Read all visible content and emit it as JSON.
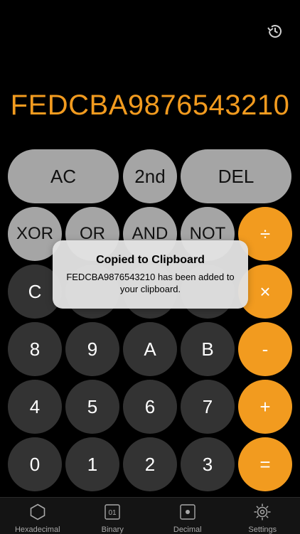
{
  "display": {
    "value": "FEDCBA9876543210"
  },
  "keypad": {
    "row1": {
      "ac": "AC",
      "second": "2nd",
      "del": "DEL"
    },
    "row2": {
      "xor": "XOR",
      "or": "OR",
      "and": "AND",
      "not": "NOT",
      "divide": "÷"
    },
    "row3": {
      "c": "C",
      "multiply": "×"
    },
    "row4": {
      "k8": "8",
      "k9": "9",
      "ka": "A",
      "kb": "B",
      "minus": "-"
    },
    "row5": {
      "k4": "4",
      "k5": "5",
      "k6": "6",
      "k7": "7",
      "plus": "+"
    },
    "row6": {
      "k0": "0",
      "k1": "1",
      "k2": "2",
      "k3": "3",
      "equals": "="
    }
  },
  "alert": {
    "title": "Copied to Clipboard",
    "message": "FEDCBA9876543210 has been added to your clipboard."
  },
  "tabs": [
    {
      "label": "Hexadecimal",
      "icon": "hexagon-icon",
      "glyph": ""
    },
    {
      "label": "Binary",
      "icon": "binary-icon",
      "glyph": "01"
    },
    {
      "label": "Decimal",
      "icon": "decimal-icon",
      "glyph": ""
    },
    {
      "label": "Settings",
      "icon": "gear-icon",
      "glyph": ""
    }
  ],
  "colors": {
    "accent": "#F29B1F",
    "light_key": "#A5A5A5",
    "dark_key": "#333333",
    "background": "#000000"
  }
}
